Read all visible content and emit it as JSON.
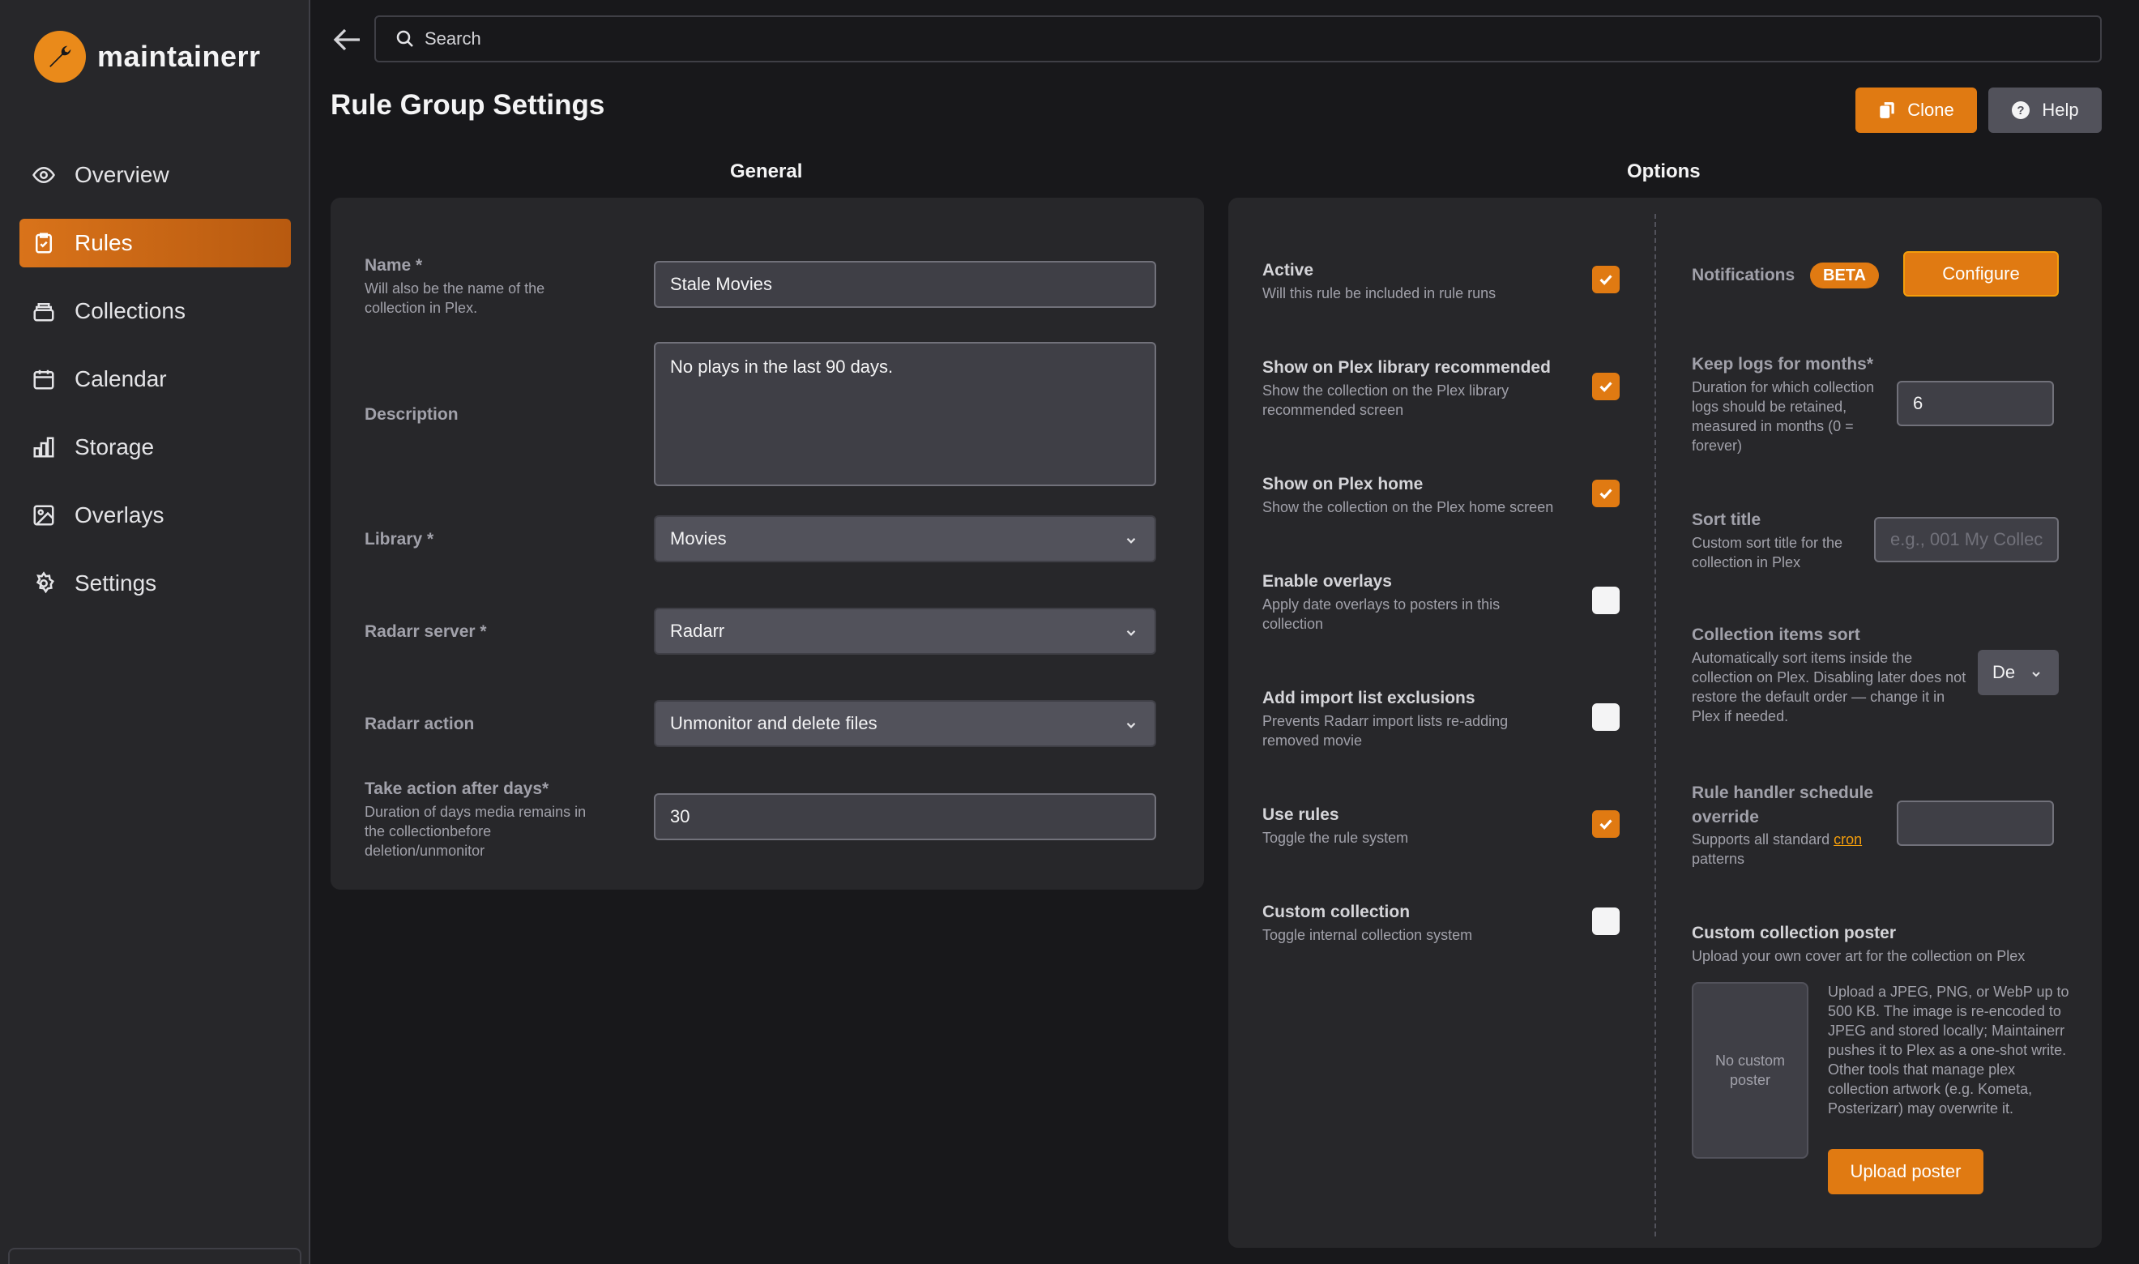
{
  "app": {
    "name": "maintainerr"
  },
  "sidebar": {
    "items": [
      {
        "label": "Overview",
        "icon": "eye-icon"
      },
      {
        "label": "Rules",
        "icon": "clipboard-check-icon",
        "active": true
      },
      {
        "label": "Collections",
        "icon": "archive-icon"
      },
      {
        "label": "Calendar",
        "icon": "calendar-icon"
      },
      {
        "label": "Storage",
        "icon": "bar-chart-icon"
      },
      {
        "label": "Overlays",
        "icon": "image-icon"
      },
      {
        "label": "Settings",
        "icon": "gear-icon"
      }
    ]
  },
  "search": {
    "placeholder": "Search"
  },
  "page": {
    "title": "Rule Group Settings",
    "clone_label": "Clone",
    "help_label": "Help"
  },
  "general": {
    "title": "General",
    "name": {
      "label": "Name *",
      "hint": "Will also be the name of the collection in Plex.",
      "value": "Stale Movies"
    },
    "description": {
      "label": "Description",
      "value": "No plays in the last 90 days."
    },
    "library": {
      "label": "Library *",
      "value": "Movies"
    },
    "radarr_server": {
      "label": "Radarr server *",
      "value": "Radarr"
    },
    "radarr_action": {
      "label": "Radarr action",
      "value": "Unmonitor and delete files"
    },
    "take_action": {
      "label": "Take action after days*",
      "hint": "Duration of days media remains in the collectionbefore deletion/unmonitor",
      "value": "30"
    }
  },
  "options": {
    "title": "Options",
    "toggles": [
      {
        "title": "Active",
        "desc": "Will this rule be included in rule runs",
        "checked": true
      },
      {
        "title": "Show on Plex library recommended",
        "desc": "Show the collection on the Plex library recommended screen",
        "checked": true
      },
      {
        "title": "Show on Plex home",
        "desc": "Show the collection on the Plex home screen",
        "checked": true
      },
      {
        "title": "Enable overlays",
        "desc": "Apply date overlays to posters in this collection",
        "checked": false
      },
      {
        "title": "Add import list exclusions",
        "desc": "Prevents Radarr import lists re-adding removed movie",
        "checked": false
      },
      {
        "title": "Use rules",
        "desc": "Toggle the rule system",
        "checked": true
      },
      {
        "title": "Custom collection",
        "desc": "Toggle internal collection system",
        "checked": false
      }
    ],
    "notifications": {
      "label": "Notifications",
      "badge": "BETA",
      "button": "Configure"
    },
    "keep_logs": {
      "label": "Keep logs for months*",
      "desc": "Duration for which collection logs should be retained, measured in months (0 = forever)",
      "value": "6"
    },
    "sort_title": {
      "label": "Sort title",
      "desc": "Custom sort title for the collection in Plex",
      "placeholder": "e.g., 001 My Collec"
    },
    "items_sort": {
      "label": "Collection items sort",
      "desc": "Automatically sort items inside the collection on Plex. Disabling later does not restore the default order — change it in Plex if needed.",
      "value": "De"
    },
    "schedule": {
      "label": "Rule handler schedule override",
      "desc_prefix": "Supports all standard",
      "link": "cron",
      "desc_suffix": "patterns",
      "value": ""
    },
    "poster": {
      "label": "Custom collection poster",
      "desc": "Upload your own cover art for the collection on Plex",
      "empty": "No custom poster",
      "info": "Upload a JPEG, PNG, or WebP up to 500 KB. The image is re-encoded to JPEG and stored locally; Maintainerr pushes it to Plex as a one-shot write. Other tools that manage plex collection artwork (e.g. Kometa, Posterizarr) may overwrite it.",
      "button": "Upload poster"
    }
  },
  "colors": {
    "accent": "#e07a12",
    "bg": "#18181b",
    "panel": "#27272a"
  }
}
